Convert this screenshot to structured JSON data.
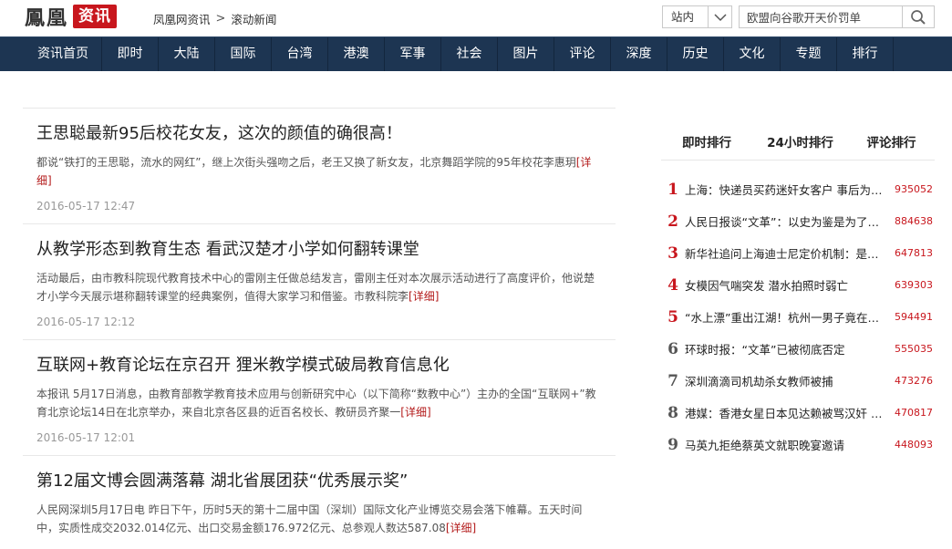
{
  "header": {
    "logo_brand": "鳳凰",
    "logo_section": "资讯",
    "breadcrumb": [
      "凤凰网资讯",
      "滚动新闻"
    ],
    "breadcrumb_sep": ">",
    "site_scope": "站内",
    "search_value": "欧盟向谷歌开天价罚单"
  },
  "nav": [
    "资讯首页",
    "即时",
    "大陆",
    "国际",
    "台湾",
    "港澳",
    "军事",
    "社会",
    "图片",
    "评论",
    "深度",
    "历史",
    "文化",
    "专题",
    "排行"
  ],
  "news": [
    {
      "title": "王思聪最新95后校花女友，这次的颜值的确很高！",
      "summary": "都说“铁打的王思聪，流水的网红”，继上次街头强吻之后，老王又换了新女友，北京舞蹈学院的95年校花李惠玥",
      "more": "[详细]",
      "time": "2016-05-17 12:47"
    },
    {
      "title": "从教学形态到教育生态 看武汉楚才小学如何翻转课堂",
      "summary": "活动最后，由市教科院现代教育技术中心的雷刚主任做总结发言，雷刚主任对本次展示活动进行了高度评价，他说楚才小学今天展示堪称翻转课堂的经典案例，值得大家学习和借鉴。市教科院李",
      "more": "[详细]",
      "time": "2016-05-17 12:12"
    },
    {
      "title": "互联网+教育论坛在京召开 狸米教学模式破局教育信息化",
      "summary": "本报讯 5月17日消息，由教育部教学教育技术应用与创新研究中心（以下简称“数教中心”）主办的全国“互联网+”教育北京论坛14日在北京举办，来自北京各区县的近百名校长、教研员齐聚一",
      "more": "[详细]",
      "time": "2016-05-17 12:01"
    },
    {
      "title": "第12届文博会圆满落幕 湖北省展团获“优秀展示奖”",
      "summary": "人民网深圳5月17日电 昨日下午，历时5天的第十二届中国（深圳）国际文化产业博览交易会落下帷幕。五天时间中，实质性成交2032.014亿元、出口交易金额176.972亿元、总参观人数达587.08",
      "more": "[详细]",
      "time": ""
    }
  ],
  "ranking": {
    "tabs": [
      "即时排行",
      "24小时排行",
      "评论排行"
    ],
    "items": [
      {
        "rank": "1",
        "title": "上海：快递员买药迷奸女客户 事后为抢劫挥刀",
        "count": "935052"
      },
      {
        "rank": "2",
        "title": "人民日报谈“文革”：以史为鉴是为了更好前进",
        "count": "884638"
      },
      {
        "rank": "3",
        "title": "新华社追问上海迪士尼定价机制：是否合理",
        "count": "647813"
      },
      {
        "rank": "4",
        "title": "女模因气喘突发 潜水拍照时弱亡",
        "count": "639303"
      },
      {
        "rank": "5",
        "title": "“水上漂”重出江湖！杭州一男子竟在水上行走",
        "count": "594491"
      },
      {
        "rank": "6",
        "title": "环球时报：“文革”已被彻底否定",
        "count": "555035"
      },
      {
        "rank": "7",
        "title": "深圳滴滴司机劫杀女教师被捕",
        "count": "473276"
      },
      {
        "rank": "8",
        "title": "港媒：香港女星日本见达赖被骂汉奸 网友怒斥",
        "count": "470817"
      },
      {
        "rank": "9",
        "title": "马英九拒绝蔡英文就职晚宴邀请",
        "count": "448093"
      }
    ]
  },
  "colors": {
    "nav_bg": "#1d3552",
    "brand_red": "#c8161d",
    "more_link": "#b31a1a",
    "time_gray": "#999999"
  },
  "icons": {
    "site_select": "chevron-down-icon",
    "search": "search-icon"
  }
}
